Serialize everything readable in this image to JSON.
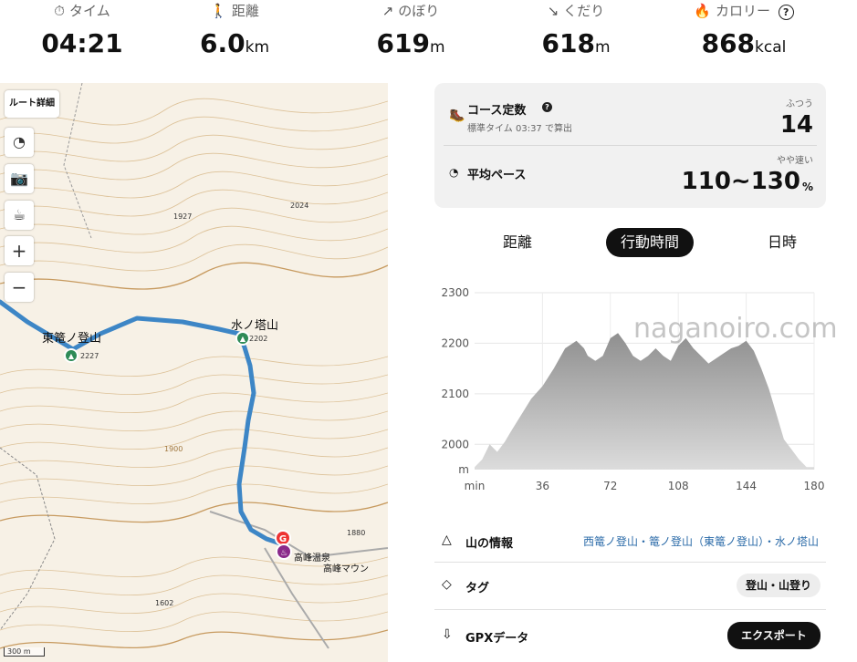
{
  "stats": [
    {
      "icon": "timer-icon",
      "glyph": "⏱",
      "label": "タイム",
      "value": "04:21",
      "unit": ""
    },
    {
      "icon": "walker-icon",
      "glyph": "🚶",
      "label": "距離",
      "value": "6.0",
      "unit": "km"
    },
    {
      "icon": "arrow-up-right-icon",
      "glyph": "↗",
      "label": "のぼり",
      "value": "619",
      "unit": "m"
    },
    {
      "icon": "arrow-down-right-icon",
      "glyph": "↘",
      "label": "くだり",
      "value": "618",
      "unit": "m"
    },
    {
      "icon": "flame-icon",
      "glyph": "🔥",
      "label": "カロリー",
      "value": "868",
      "unit": "kcal"
    }
  ],
  "calorie_help": "?",
  "map": {
    "route_detail_label": "ルート詳細",
    "buttons": [
      {
        "name": "speedometer-icon",
        "glyph": "◔"
      },
      {
        "name": "camera-icon",
        "glyph": "📷"
      },
      {
        "name": "cup-icon",
        "glyph": "☕"
      },
      {
        "name": "zoom-in-icon",
        "glyph": "+"
      },
      {
        "name": "zoom-out-icon",
        "glyph": "−"
      }
    ],
    "labels": {
      "peak1": "東篭ノ登山",
      "peak1_elev": "2227",
      "peak2": "水ノ塔山",
      "peak2_elev": "2202",
      "spot1": "1927",
      "spot2": "2024",
      "spot3": "1880",
      "spot4": "1602",
      "spot5": "1900",
      "onsen": "高峰温泉",
      "mountain": "高峰マウン",
      "goal": "G",
      "scale": "300 m"
    }
  },
  "course": {
    "constant_label": "コース定数",
    "constant_help": "?",
    "standard_time": "標準タイム 03:37 で算出",
    "difficulty": "ふつう",
    "constant_value": "14",
    "pace_label": "平均ペース",
    "pace_rating": "やや速い",
    "pace_value": "110~130",
    "pace_unit": "%"
  },
  "tabs": [
    "距離",
    "行動時間",
    "日時"
  ],
  "active_tab": 1,
  "watermark": "naganoiro.com",
  "chart_data": {
    "type": "area",
    "xlabel": "min",
    "ylabel": "m",
    "x_ticks": [
      "36",
      "72",
      "108",
      "144",
      "180"
    ],
    "y_ticks": [
      "2000",
      "2100",
      "2200",
      "2300"
    ],
    "xlim": [
      0,
      180
    ],
    "ylim": [
      1950,
      2300
    ],
    "x": [
      0,
      4,
      8,
      12,
      16,
      20,
      25,
      30,
      36,
      42,
      48,
      54,
      58,
      60,
      64,
      68,
      72,
      76,
      80,
      84,
      88,
      92,
      96,
      100,
      104,
      108,
      112,
      116,
      120,
      124,
      128,
      132,
      136,
      140,
      144,
      148,
      152,
      156,
      160,
      164,
      168,
      172,
      176,
      180
    ],
    "values": [
      1955,
      1970,
      2000,
      1985,
      2005,
      2030,
      2060,
      2090,
      2115,
      2150,
      2190,
      2205,
      2190,
      2175,
      2165,
      2175,
      2210,
      2220,
      2200,
      2175,
      2165,
      2175,
      2190,
      2175,
      2165,
      2195,
      2210,
      2190,
      2175,
      2160,
      2170,
      2180,
      2190,
      2195,
      2205,
      2185,
      2150,
      2110,
      2060,
      2010,
      1990,
      1970,
      1955,
      1955
    ],
    "grid": true
  },
  "info": {
    "mountains_label": "山の情報",
    "mountains_value": "西篭ノ登山・篭ノ登山（東篭ノ登山）・水ノ塔山",
    "tags_label": "タグ",
    "tags_value": "登山・山登り",
    "gpx_label": "GPXデータ",
    "export_label": "エクスポート"
  }
}
